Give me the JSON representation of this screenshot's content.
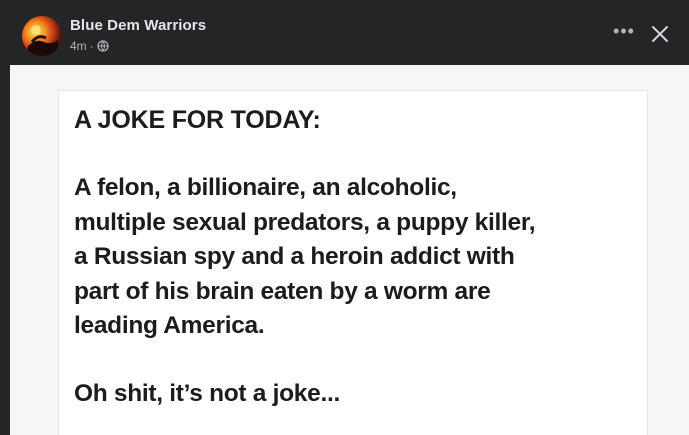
{
  "post": {
    "page_name": "Blue Dem Warriors",
    "timestamp": "4m",
    "separator": "·",
    "privacy_icon": "globe-icon",
    "more_label": "•••",
    "close_icon": "close-icon"
  },
  "image": {
    "title": "A JOKE FOR TODAY:",
    "body_lines": [
      "A felon, a billionaire, an alcoholic,",
      "multiple sexual predators, a puppy killer,",
      "a Russian spy and a heroin addict with",
      "part of his brain eaten by a worm are",
      "leading America."
    ],
    "punchline": "Oh shit, it’s not a joke..."
  },
  "colors": {
    "panel_background": "#242526",
    "primary_text": "#e4e6eb",
    "secondary_text": "#b0b3b8",
    "image_text": "#1c1c1c"
  }
}
